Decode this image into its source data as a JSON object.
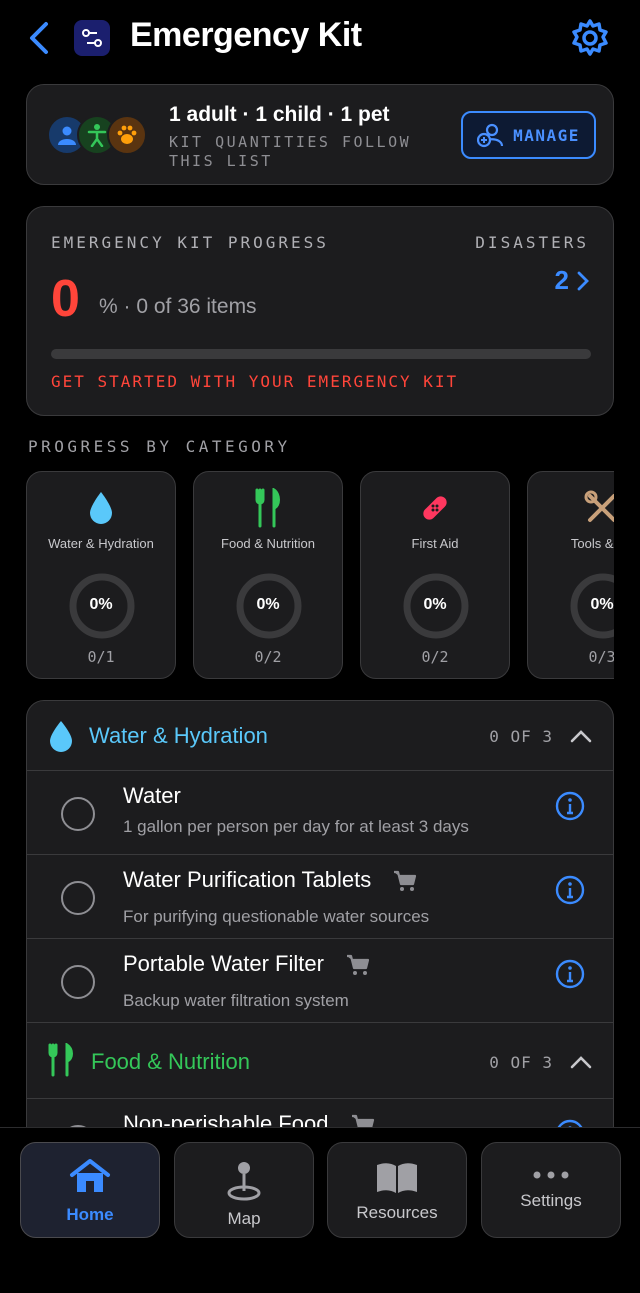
{
  "header": {
    "title": "Emergency Kit"
  },
  "household": {
    "summary": "1 adult · 1 child · 1 pet",
    "subtitle": "KIT QUANTITIES FOLLOW THIS LIST",
    "manage_label": "MANAGE"
  },
  "progress": {
    "label": "EMERGENCY KIT PROGRESS",
    "percent": "0",
    "detail": "% · 0 of 36 items",
    "fraction": 0,
    "disasters_label": "DISASTERS",
    "disasters_count": "2",
    "cta": "GET STARTED WITH YOUR EMERGENCY KIT"
  },
  "categories_label": "PROGRESS BY CATEGORY",
  "categories": [
    {
      "name": "Water & Hydration",
      "percent": "0%",
      "count": "0/1",
      "icon": "water-drop-icon"
    },
    {
      "name": "Food & Nutrition",
      "percent": "0%",
      "count": "0/2",
      "icon": "fork-knife-icon"
    },
    {
      "name": "First Aid",
      "percent": "0%",
      "count": "0/2",
      "icon": "bandage-icon"
    },
    {
      "name": "Tools & Su",
      "percent": "0%",
      "count": "0/3",
      "icon": "tools-icon"
    }
  ],
  "sections": [
    {
      "title": "Water & Hydration",
      "count": "0 OF 3",
      "items": [
        {
          "name": "Water",
          "desc": "1 gallon per person per day for at least 3 days",
          "cart": false
        },
        {
          "name": "Water Purification Tablets",
          "desc": "For purifying questionable water sources",
          "cart": true
        },
        {
          "name": "Portable Water Filter",
          "desc": "Backup water filtration system",
          "cart": true
        }
      ]
    },
    {
      "title": "Food & Nutrition",
      "count": "0 OF 3",
      "items": [
        {
          "name": "Non-perishable Food",
          "desc": "",
          "cart": true
        }
      ]
    }
  ],
  "tabs": [
    {
      "label": "Home",
      "icon": "home-icon",
      "active": true
    },
    {
      "label": "Map",
      "icon": "map-pin-icon",
      "active": false
    },
    {
      "label": "Resources",
      "icon": "book-icon",
      "active": false
    },
    {
      "label": "Settings",
      "icon": "more-icon",
      "active": false
    }
  ],
  "colors": {
    "accent": "#3b8bff",
    "danger": "#ff453a",
    "water": "#5ac8fa",
    "food": "#34c759",
    "first_aid": "#ff375f",
    "tools": "#c8a07a"
  }
}
